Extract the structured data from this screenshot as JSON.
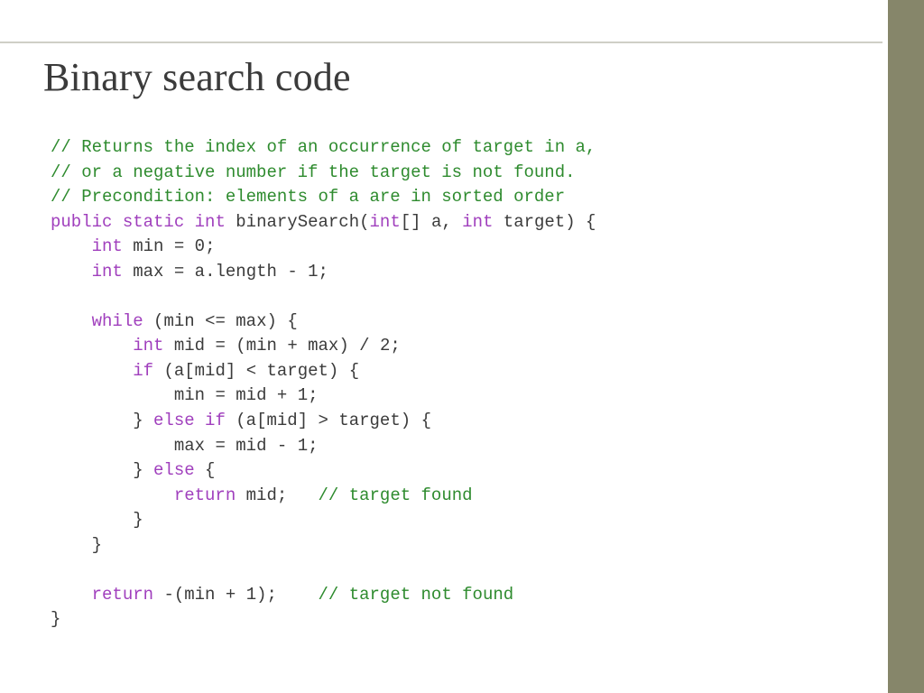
{
  "title": "Binary search code",
  "comment1": "// Returns the index of an occurrence of target in a,",
  "comment2": "// or a negative number if the target is not found.",
  "comment3": "// Precondition: elements of a are in sorted order",
  "kw_public": "public",
  "kw_static": "static",
  "kw_int": "int",
  "fn_name": "binarySearch",
  "param_a": "a",
  "param_target": "target",
  "brace_open": "{",
  "brace_close": "}",
  "var_min": "min",
  "var_max": "max",
  "var_mid": "mid",
  "num_0": "0",
  "num_1": "1",
  "num_2": "2",
  "field_length": "length",
  "kw_while": "while",
  "kw_if": "if",
  "kw_else": "else",
  "kw_return": "return",
  "cmt_found": "// target found",
  "cmt_notfound": "// target not found",
  "op_eq": "=",
  "op_le": "<=",
  "op_lt": "<",
  "op_gt": ">",
  "op_plus": "+",
  "op_minus": "-",
  "op_div": "/",
  "op_semi": ";",
  "op_comma": ",",
  "op_dot": ".",
  "op_lparen": "(",
  "op_rparen": ")",
  "op_lbrack": "[",
  "op_rbrack": "]",
  "op_arr": "[]"
}
